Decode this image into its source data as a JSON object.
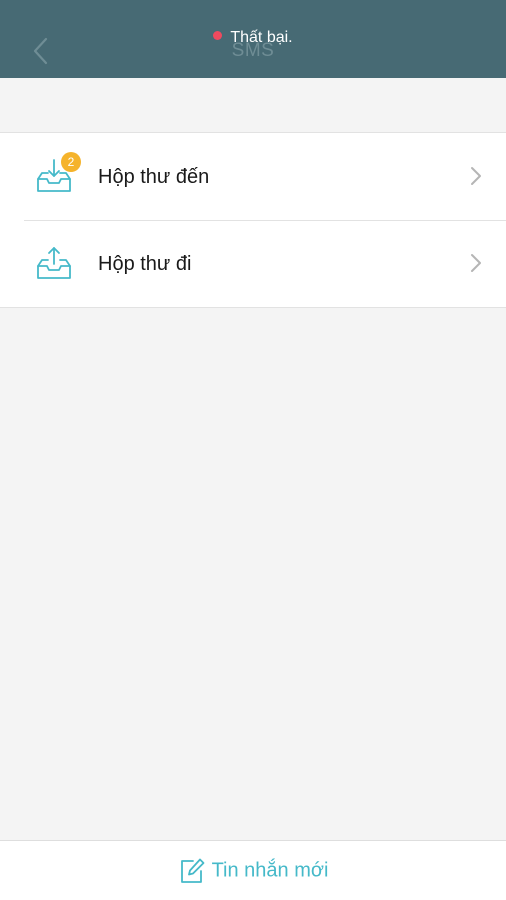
{
  "header": {
    "title": "SMS",
    "back_icon": "chevron-left-icon",
    "background_color": "#476a74"
  },
  "toast": {
    "text": "Thất bại.",
    "dot_color": "#ef4a5f"
  },
  "mailboxes": [
    {
      "label": "Hộp thư đến",
      "icon": "inbox-download-icon",
      "badge": "2"
    },
    {
      "label": "Hộp thư đi",
      "icon": "outbox-upload-icon"
    }
  ],
  "footer": {
    "new_message_label": "Tin nhắn mới",
    "icon": "compose-icon",
    "accent_color": "#45b9c9"
  },
  "colors": {
    "accent": "#45b9c9",
    "badge": "#f5b32b"
  }
}
